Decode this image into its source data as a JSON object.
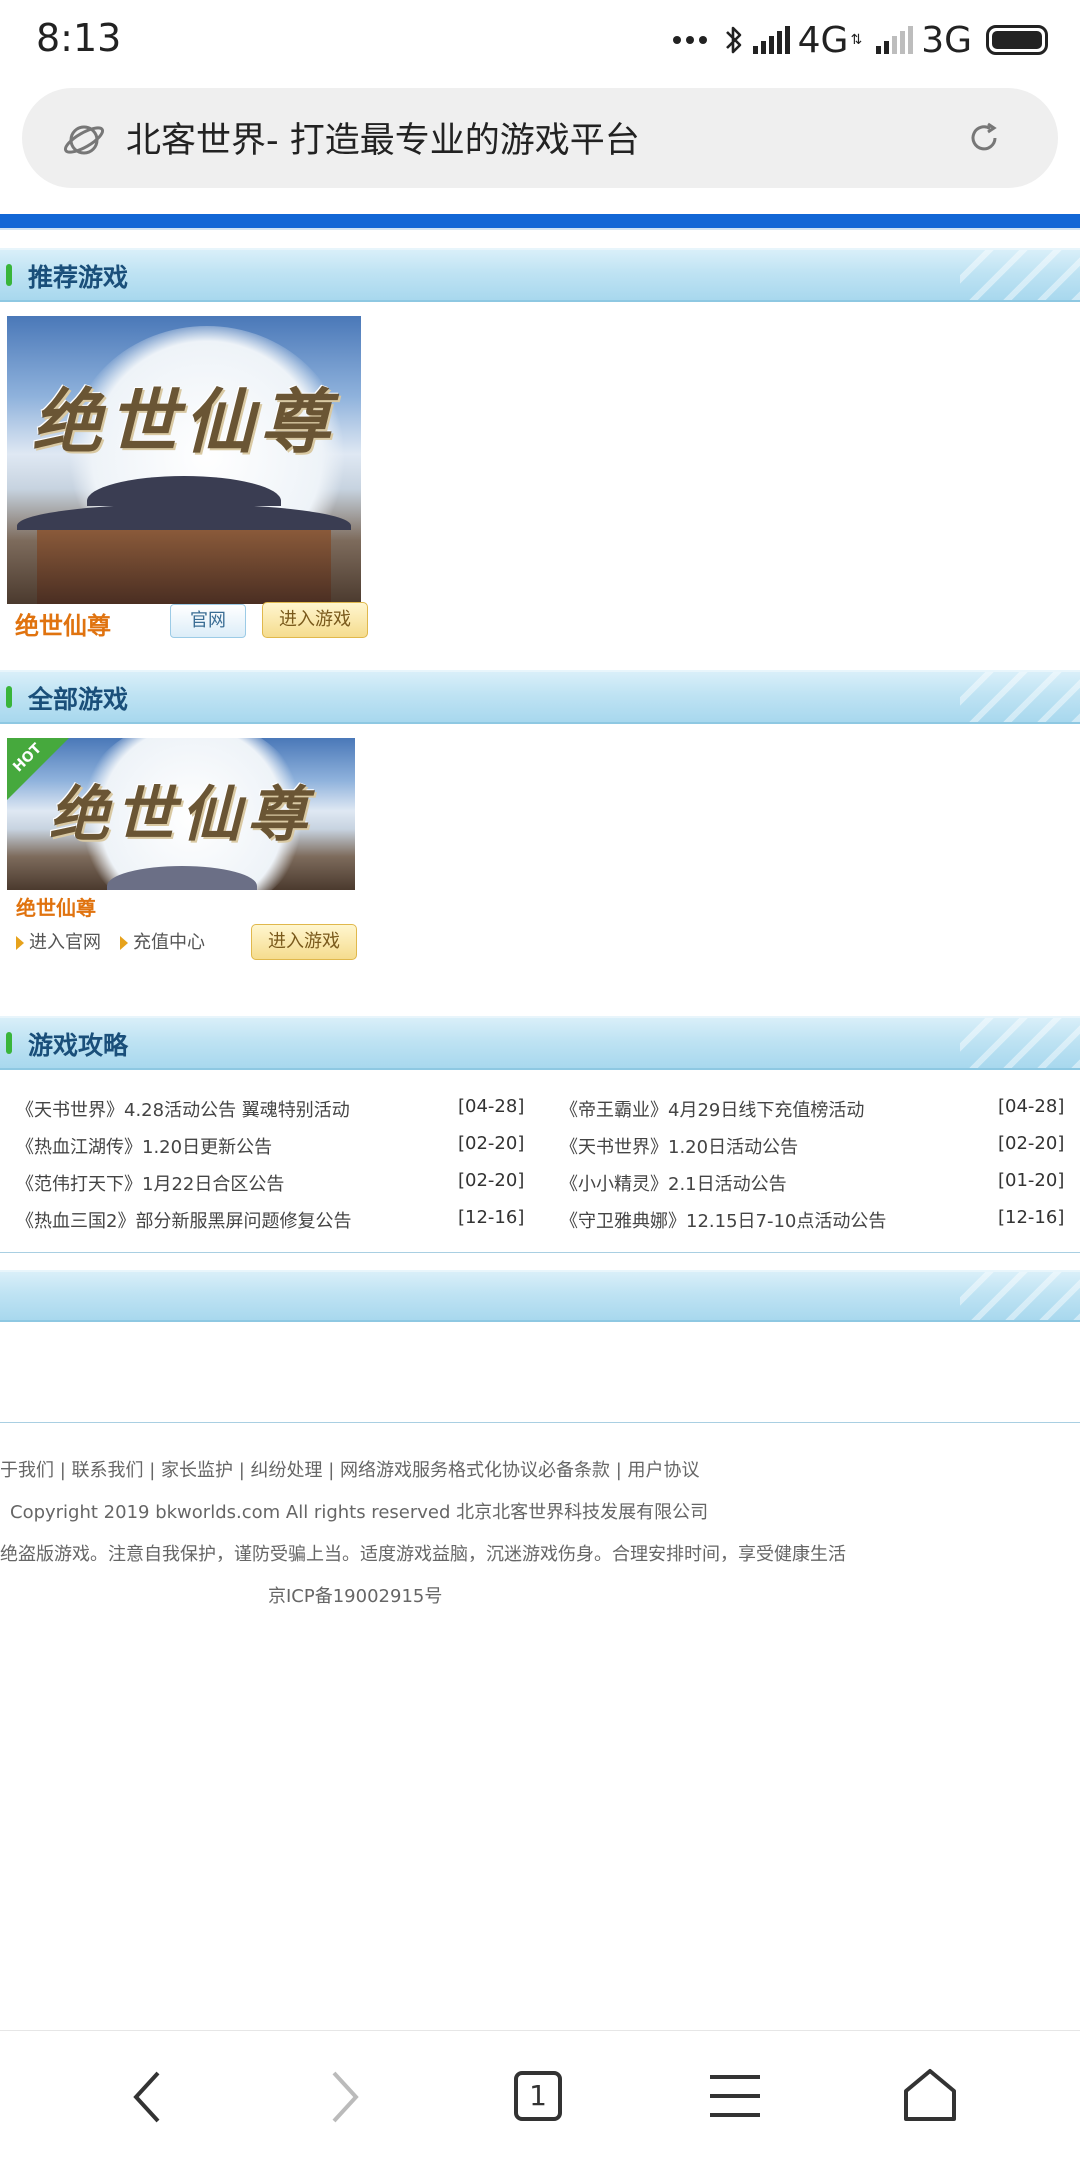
{
  "status_bar": {
    "time": "8:13",
    "network_primary": "4G",
    "network_secondary": "3G"
  },
  "browser": {
    "url_title": "北客世界- 打造最专业的游戏平台",
    "tab_count": "1"
  },
  "sections": {
    "recommended_title": "推荐游戏",
    "all_games_title": "全部游戏",
    "guides_title": "游戏攻略"
  },
  "recommended": {
    "art_text": "绝世仙尊",
    "name": "绝世仙尊",
    "official_btn": "官网",
    "enter_btn": "进入游戏"
  },
  "all_games": {
    "badge": "HOT",
    "art_text": "绝世仙尊",
    "name": "绝世仙尊",
    "link_official": "进入官网",
    "link_recharge": "充值中心",
    "enter_btn": "进入游戏"
  },
  "news": [
    {
      "title": "《天书世界》4.28活动公告 翼魂特别活动",
      "date": "[04-28]"
    },
    {
      "title": "《帝王霸业》4月29日线下充值榜活动",
      "date": "[04-28]"
    },
    {
      "title": "《热血江湖传》1.20日更新公告",
      "date": "[02-20]"
    },
    {
      "title": "《天书世界》1.20日活动公告",
      "date": "[02-20]"
    },
    {
      "title": "《范伟打天下》1月22日合区公告",
      "date": "[02-20]"
    },
    {
      "title": "《小小精灵》2.1日活动公告",
      "date": "[01-20]"
    },
    {
      "title": "《热血三国2》部分新服黑屏问题修复公告",
      "date": "[12-16]"
    },
    {
      "title": "《守卫雅典娜》12.15日7-10点活动公告",
      "date": "[12-16]"
    }
  ],
  "footer": {
    "links": "于我们 | 联系我们 | 家长监护 | 纠纷处理 | 网络游戏服务格式化协议必备条款 | 用户协议",
    "copyright": "Copyright 2019 bkworlds.com All rights reserved 北京北客世界科技发展有限公司",
    "notice": "绝盗版游戏。注意自我保护，谨防受骗上当。适度游戏益脑，沉迷游戏伤身。合理安排时间，享受健康生活",
    "icp": "京ICP备19002915号"
  },
  "colors": {
    "accent_blue": "#1267d6",
    "game_name_orange": "#e0730f",
    "section_title": "#1a4f7a"
  }
}
